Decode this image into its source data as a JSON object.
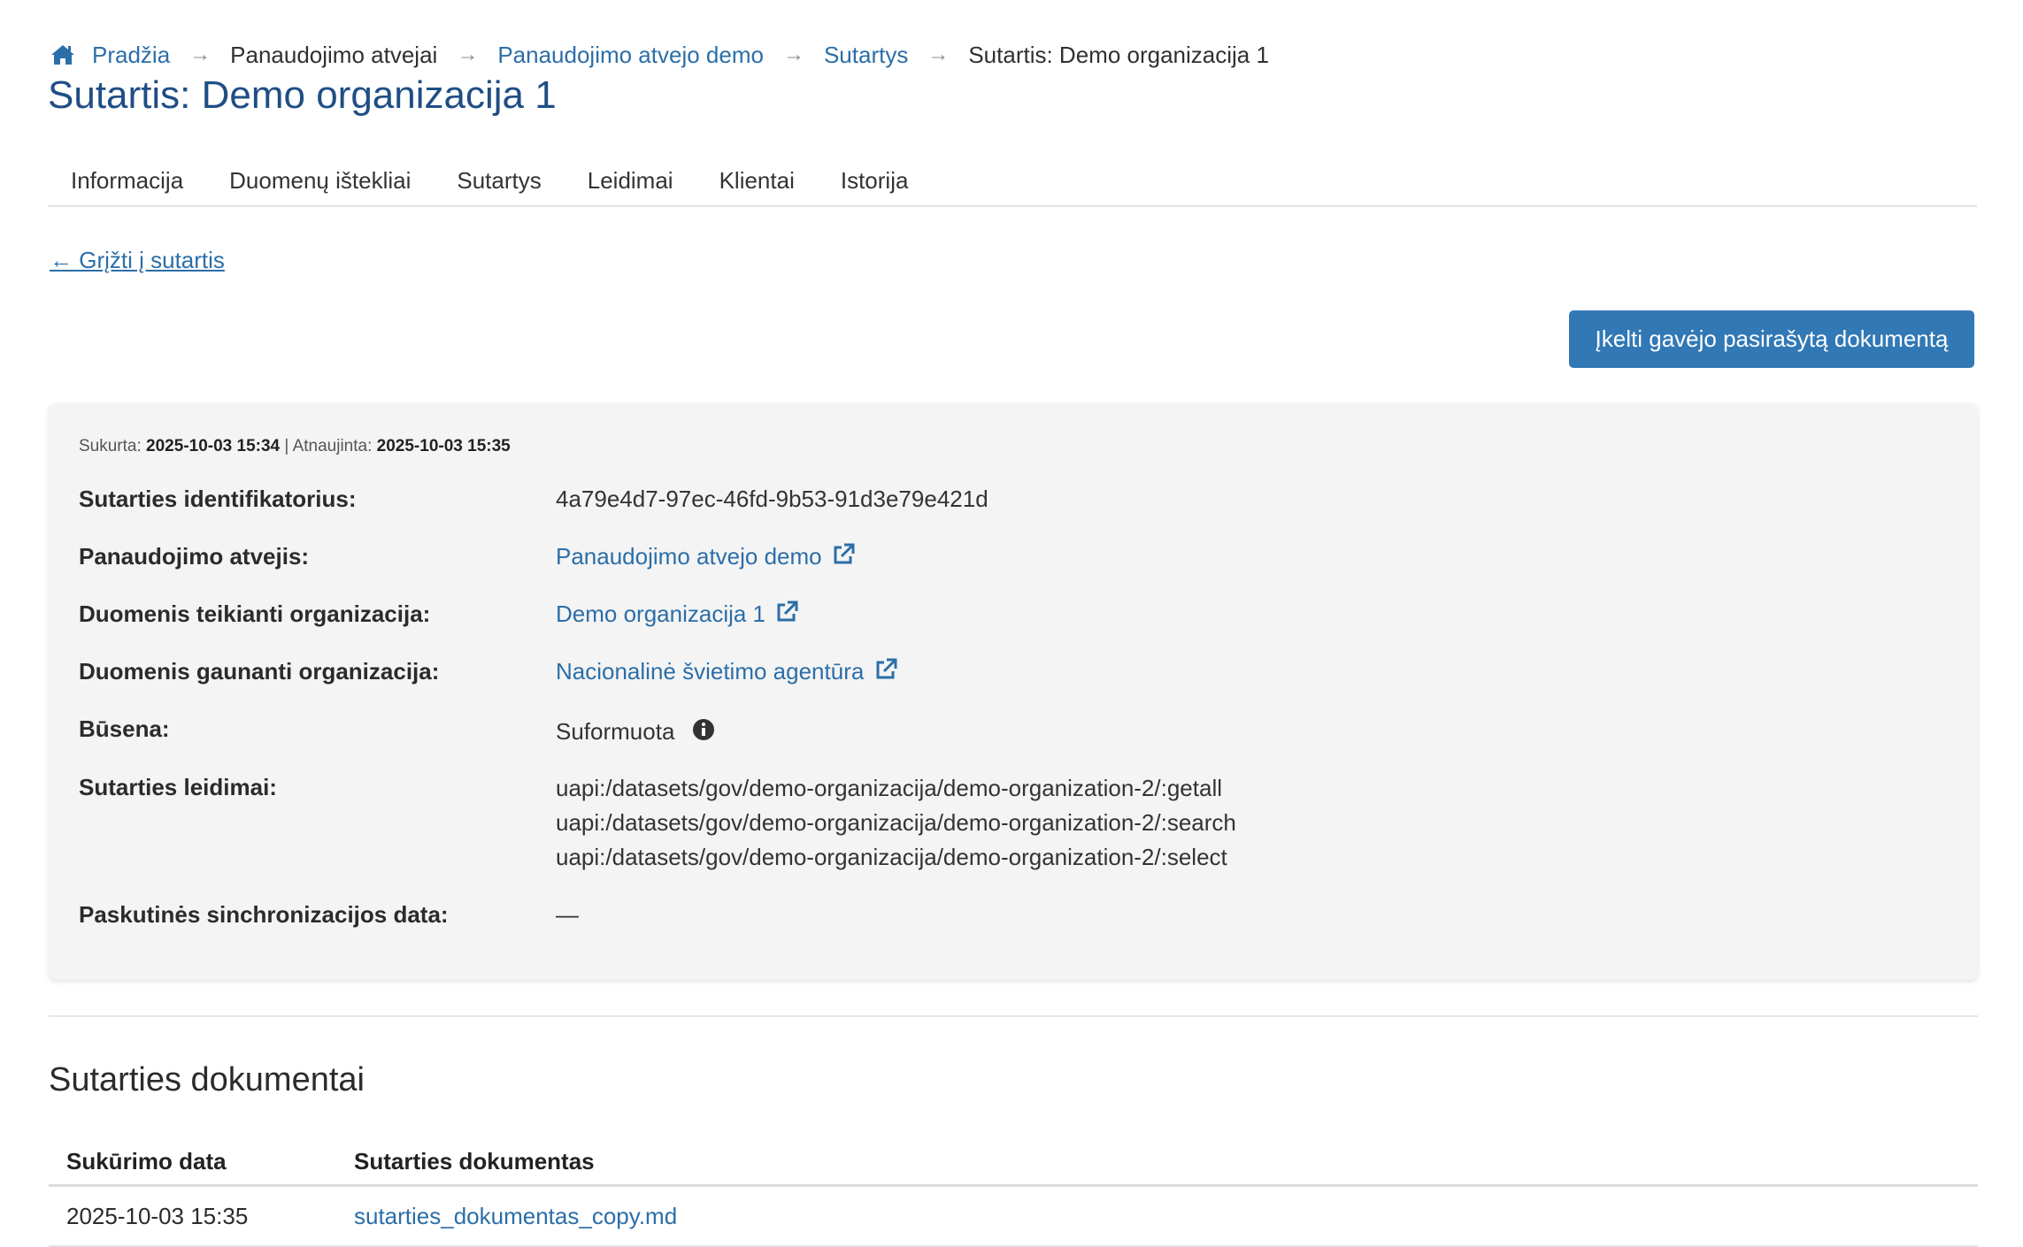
{
  "breadcrumb": {
    "home": "Pradžia",
    "use_cases": "Panaudojimo atvejai",
    "use_case_demo": "Panaudojimo atvejo demo",
    "agreements": "Sutartys",
    "current": "Sutartis: Demo organizacija 1",
    "separator": "→"
  },
  "page_title": "Sutartis: Demo organizacija 1",
  "tabs": [
    "Informacija",
    "Duomenų ištekliai",
    "Sutartys",
    "Leidimai",
    "Klientai",
    "Istorija"
  ],
  "back_link": "← Grįžti į sutartis",
  "upload_button": "Įkelti gavėjo pasirašytą dokumentą",
  "meta": {
    "created_label": "Sukurta:",
    "created_value": "2025-10-03 15:34",
    "separator": "|",
    "updated_label": "Atnaujinta:",
    "updated_value": "2025-10-03 15:35"
  },
  "details": {
    "id_label": "Sutarties identifikatorius:",
    "id_value": "4a79e4d7-97ec-46fd-9b53-91d3e79e421d",
    "use_case_label": "Panaudojimo atvejis:",
    "use_case_value": "Panaudojimo atvejo demo",
    "provider_label": "Duomenis teikianti organizacija:",
    "provider_value": "Demo organizacija 1",
    "receiver_label": "Duomenis gaunanti organizacija:",
    "receiver_value": "Nacionalinė švietimo agentūra",
    "status_label": "Būsena:",
    "status_value": "Suformuota",
    "permissions_label": "Sutarties leidimai:",
    "permissions": [
      "uapi:/datasets/gov/demo-organizacija/demo-organization-2/:getall",
      "uapi:/datasets/gov/demo-organizacija/demo-organization-2/:search",
      "uapi:/datasets/gov/demo-organizacija/demo-organization-2/:select"
    ],
    "last_sync_label": "Paskutinės sinchronizacijos data:",
    "last_sync_value": "—"
  },
  "documents": {
    "title": "Sutarties dokumentai",
    "columns": [
      "Sukūrimo data",
      "Sutarties dokumentas"
    ],
    "rows": [
      {
        "date": "2025-10-03 15:35",
        "file": "sutarties_dokumentas_copy.md"
      }
    ]
  },
  "colors": {
    "link": "#2b6ea8",
    "title": "#1f4e85",
    "button": "#3178b5",
    "card": "#f4f4f4"
  },
  "icons": [
    "home-icon",
    "arrow-right-icon",
    "external-link-icon",
    "info-icon"
  ]
}
